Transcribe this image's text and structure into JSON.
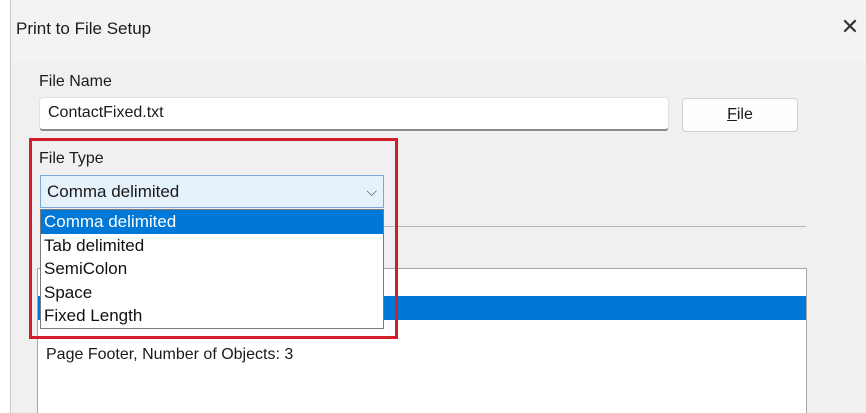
{
  "window": {
    "title": "Print to File Setup",
    "close_glyph": "✕"
  },
  "file_name": {
    "label": "File Name",
    "value": "ContactFixed.txt"
  },
  "file_button": {
    "label_mnemonic": "F",
    "label_rest": "ile"
  },
  "file_type": {
    "label": "File Type",
    "selected": "Comma delimited",
    "arrow_glyph": "⌵",
    "options": [
      "Comma delimited",
      "Tab delimited",
      "SemiColon",
      "Space",
      "Fixed Length"
    ]
  },
  "sections_list": {
    "items": [
      "",
      "",
      "Page Footer, Number of Objects: 3"
    ]
  },
  "colors": {
    "highlight": "#d11f2a",
    "selection": "#0078d7"
  }
}
